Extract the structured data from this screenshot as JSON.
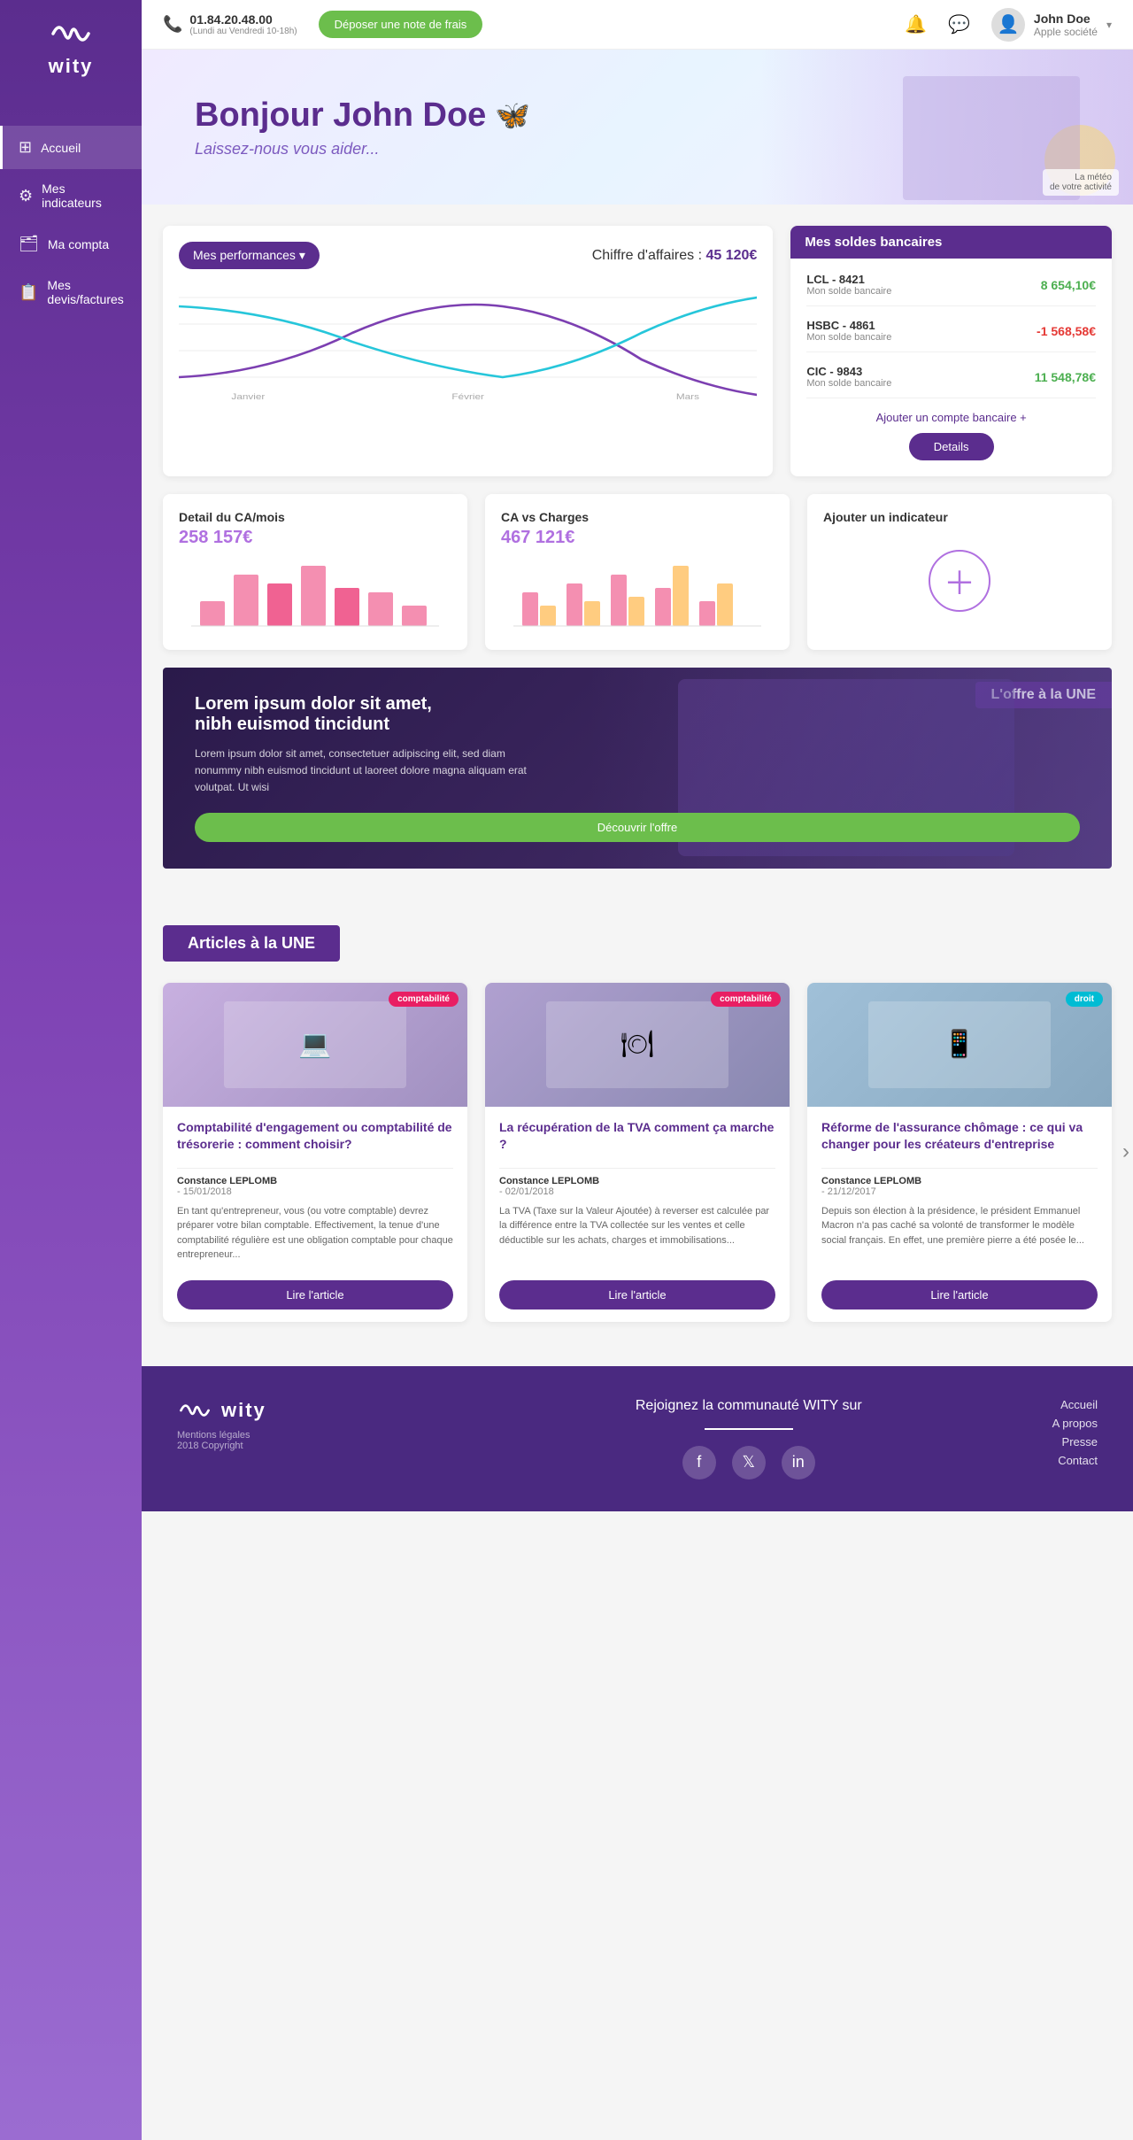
{
  "brand": {
    "name": "wity"
  },
  "topbar": {
    "phone_number": "01.84.20.48.00",
    "phone_hours": "(Lundi au Vendredi 10-18h)",
    "cta_label": "Déposer une note de frais",
    "user_name": "John Doe",
    "user_company": "Apple société"
  },
  "hero": {
    "greeting": "Bonjour John Doe",
    "sub": "Laissez-nous vous aider...",
    "butterfly": "🦋",
    "badge": "La météo\nde votre activité"
  },
  "sidebar": {
    "items": [
      {
        "label": "Accueil",
        "icon": "🏠",
        "active": true
      },
      {
        "label": "Mes indicateurs",
        "icon": "📊"
      },
      {
        "label": "Ma compta",
        "icon": "📁"
      },
      {
        "label": "Mes devis/factures",
        "icon": "📝"
      }
    ]
  },
  "performance": {
    "title": "Mes performances",
    "ca_label": "Chiffre d'affaires :",
    "ca_value": "45 120€",
    "chart_months": [
      "Janvier",
      "Février",
      "Mars"
    ]
  },
  "bank": {
    "header": "Mes soldes bancaires",
    "entries": [
      {
        "name": "LCL - 8421",
        "sub": "Mon solde bancaire",
        "amount": "8 654,10€",
        "positive": true
      },
      {
        "name": "HSBC - 4861",
        "sub": "Mon solde bancaire",
        "amount": "-1 568,58€",
        "positive": false
      },
      {
        "name": "CIC - 9843",
        "sub": "Mon solde bancaire",
        "amount": "11 548,78€",
        "positive": true
      }
    ],
    "add_label": "Ajouter un compte bancaire +",
    "details_label": "Details"
  },
  "mini_cards": [
    {
      "title": "Detail du CA/mois",
      "amount": "258 157€",
      "chart_type": "bar_pink"
    },
    {
      "title": "CA vs Charges",
      "amount": "467 121€",
      "chart_type": "bar_mixed"
    },
    {
      "title": "Ajouter un indicateur",
      "amount": "",
      "chart_type": "add"
    }
  ],
  "offer": {
    "label": "L'offre à la UNE",
    "title": "Lorem ipsum dolor sit amet,\nnibh euismod tincidunt",
    "desc": "Lorem ipsum dolor sit amet, consectetuer adipiscing elit, sed diam nonummy nibh euismod tincidunt ut laoreet dolore magna aliquam erat volutpat. Ut wisi",
    "btn_label": "Découvrir l'offre"
  },
  "articles": {
    "header": "Articles à la UNE",
    "items": [
      {
        "tag": "comptabilité",
        "tag_type": "compta",
        "img_bg": "#d4c5e8",
        "title": "Comptabilité d'engagement ou comptabilité de trésorerie : comment choisir?",
        "author": "Constance LEPLOMB",
        "date": "15/01/2018",
        "excerpt": "En tant qu'entrepreneur, vous (ou votre comptable) devrez préparer votre bilan comptable. Effectivement, la tenue d'une comptabilité régulière est une obligation comptable pour chaque entrepreneur...",
        "btn_label": "Lire l'article"
      },
      {
        "tag": "comptabilité",
        "tag_type": "compta",
        "img_bg": "#c8b8d8",
        "title": "La récupération de la TVA comment ça marche ?",
        "author": "Constance LEPLOMB",
        "date": "02/01/2018",
        "excerpt": "La TVA (Taxe sur la Valeur Ajoutée) à reverser est calculée par la différence entre la TVA collectée sur les ventes et celle déductible sur les achats, charges et immobilisations...",
        "btn_label": "Lire l'article"
      },
      {
        "tag": "droit",
        "tag_type": "droit",
        "img_bg": "#b8d0e8",
        "title": "Réforme de l'assurance chômage : ce qui va changer pour les créateurs d'entreprise",
        "author": "Constance LEPLOMB",
        "date": "21/12/2017",
        "excerpt": "Depuis son élection à la présidence, le président Emmanuel Macron n'a pas caché sa volonté de transformer le modèle social français. En effet, une première pierre a été posée le...",
        "btn_label": "Lire l'article"
      }
    ]
  },
  "footer": {
    "community_title": "Rejoignez la communauté WITY sur",
    "links": [
      "Accueil",
      "A propos",
      "Presse",
      "Contact"
    ],
    "legal": "Mentions légales",
    "copyright": "2018 Copyright"
  }
}
